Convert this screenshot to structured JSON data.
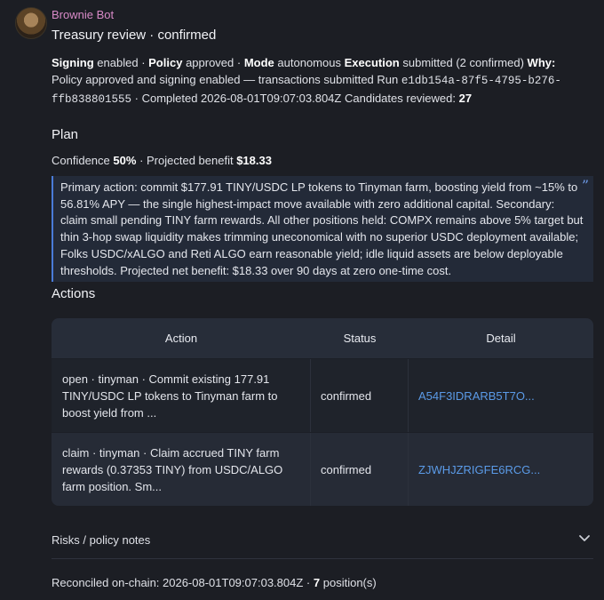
{
  "message": {
    "bot_name": "Brownie Bot",
    "title": "Treasury review · confirmed"
  },
  "status": {
    "signing_label": "Signing",
    "signing_value": "enabled",
    "policy_label": "Policy",
    "policy_value": "approved",
    "mode_label": "Mode",
    "mode_value": "autonomous",
    "execution_label": "Execution",
    "execution_value": "submitted (2 confirmed)",
    "why_label": "Why:",
    "why_text": "Policy approved and signing enabled — transactions submitted",
    "run_label": "Run",
    "run_id": "e1db154a-87f5-4795-b276-ffb838801555",
    "completed_text": "· Completed 2026-08-01T09:07:03.804Z",
    "candidates_label": "Candidates reviewed:",
    "candidates_value": "27"
  },
  "plan": {
    "title": "Plan",
    "confidence_label": "Confidence",
    "confidence_value": "50%",
    "benefit_label": "· Projected benefit",
    "benefit_value": "$18.33",
    "summary": "Primary action: commit $177.91 TINY/USDC LP tokens to Tinyman farm, boosting yield from ~15% to 56.81% APY — the single highest-impact move available with zero additional capital. Secondary: claim small pending TINY farm rewards. All other positions held: COMPX remains above 5% target but thin 3-hop swap liquidity makes trimming uneconomical with no superior USDC deployment available; Folks USDC/xALGO and Reti ALGO earn reasonable yield; idle liquid assets are below deployable thresholds. Projected net benefit: $18.33 over 90 days at zero one-time cost.",
    "quote_icon": "quote-icon"
  },
  "actions": {
    "title": "Actions",
    "headers": [
      "Action",
      "Status",
      "Detail"
    ],
    "rows": [
      {
        "action": "open · tinyman · Commit existing 177.91 TINY/USDC LP tokens to Tinyman farm to boost yield from ...",
        "status": "confirmed",
        "detail": "A54F3IDRARB5T7O..."
      },
      {
        "action": "claim · tinyman · Claim accrued TINY farm rewards (0.37353 TINY) from USDC/ALGO farm position. Sm...",
        "status": "confirmed",
        "detail": "ZJWHJZRIGFE6RCG..."
      }
    ]
  },
  "risks": {
    "label": "Risks / policy notes",
    "icon": "chevron-down-icon"
  },
  "footer": {
    "reconciled_text": "Reconciled on-chain: 2026-08-01T09:07:03.804Z ·",
    "positions_value": "7",
    "positions_label": "position(s)"
  },
  "colors": {
    "background": "#1c1e24",
    "bot_name": "#d88ac7",
    "link": "#5b9be8",
    "quote_border": "#4a7bd8"
  }
}
